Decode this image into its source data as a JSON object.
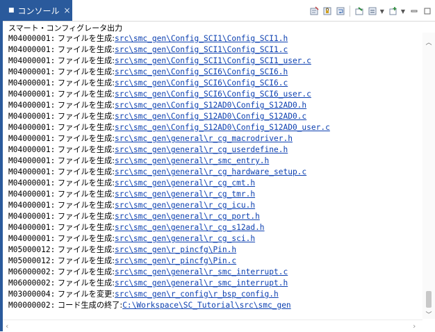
{
  "tab": {
    "icon": "console-icon",
    "label": "コンソール",
    "close": "×"
  },
  "toolbar": {
    "buttons": [
      "clear-console-icon",
      "scroll-lock-icon",
      "word-wrap-icon",
      "pin-console-icon",
      "display-selected-console-icon",
      "open-console-icon",
      "minimize-icon",
      "maximize-icon"
    ]
  },
  "console": {
    "title": "スマート・コンフィグレータ出力",
    "lines": [
      {
        "code": "M04000001:",
        "msg": " ファイルを生成:",
        "link": "src\\smc_gen\\Config_SCI1\\Config_SCI1.h"
      },
      {
        "code": "M04000001:",
        "msg": " ファイルを生成:",
        "link": "src\\smc_gen\\Config_SCI1\\Config_SCI1.c"
      },
      {
        "code": "M04000001:",
        "msg": " ファイルを生成:",
        "link": "src\\smc_gen\\Config_SCI1\\Config_SCI1_user.c"
      },
      {
        "code": "M04000001:",
        "msg": " ファイルを生成:",
        "link": "src\\smc_gen\\Config_SCI6\\Config_SCI6.h"
      },
      {
        "code": "M04000001:",
        "msg": " ファイルを生成:",
        "link": "src\\smc_gen\\Config_SCI6\\Config_SCI6.c"
      },
      {
        "code": "M04000001:",
        "msg": " ファイルを生成:",
        "link": "src\\smc_gen\\Config_SCI6\\Config_SCI6_user.c"
      },
      {
        "code": "M04000001:",
        "msg": " ファイルを生成:",
        "link": "src\\smc_gen\\Config_S12AD0\\Config_S12AD0.h"
      },
      {
        "code": "M04000001:",
        "msg": " ファイルを生成:",
        "link": "src\\smc_gen\\Config_S12AD0\\Config_S12AD0.c"
      },
      {
        "code": "M04000001:",
        "msg": " ファイルを生成:",
        "link": "src\\smc_gen\\Config_S12AD0\\Config_S12AD0_user.c"
      },
      {
        "code": "M04000001:",
        "msg": " ファイルを生成:",
        "link": "src\\smc_gen\\general\\r_cg_macrodriver.h"
      },
      {
        "code": "M04000001:",
        "msg": " ファイルを生成:",
        "link": "src\\smc_gen\\general\\r_cg_userdefine.h"
      },
      {
        "code": "M04000001:",
        "msg": " ファイルを生成:",
        "link": "src\\smc_gen\\general\\r_smc_entry.h"
      },
      {
        "code": "M04000001:",
        "msg": " ファイルを生成:",
        "link": "src\\smc_gen\\general\\r_cg_hardware_setup.c"
      },
      {
        "code": "M04000001:",
        "msg": " ファイルを生成:",
        "link": "src\\smc_gen\\general\\r_cg_cmt.h"
      },
      {
        "code": "M04000001:",
        "msg": " ファイルを生成:",
        "link": "src\\smc_gen\\general\\r_cg_tmr.h"
      },
      {
        "code": "M04000001:",
        "msg": " ファイルを生成:",
        "link": "src\\smc_gen\\general\\r_cg_icu.h"
      },
      {
        "code": "M04000001:",
        "msg": " ファイルを生成:",
        "link": "src\\smc_gen\\general\\r_cg_port.h"
      },
      {
        "code": "M04000001:",
        "msg": " ファイルを生成:",
        "link": "src\\smc_gen\\general\\r_cg_s12ad.h"
      },
      {
        "code": "M04000001:",
        "msg": " ファイルを生成:",
        "link": "src\\smc_gen\\general\\r_cg_sci.h"
      },
      {
        "code": "M05000012:",
        "msg": " ファイルを生成:",
        "link": "src\\smc_gen\\r_pincfg\\Pin.h"
      },
      {
        "code": "M05000012:",
        "msg": " ファイルを生成:",
        "link": "src\\smc_gen\\r_pincfg\\Pin.c"
      },
      {
        "code": "M06000002:",
        "msg": " ファイルを生成:",
        "link": "src\\smc_gen\\general\\r_smc_interrupt.c"
      },
      {
        "code": "M06000002:",
        "msg": " ファイルを生成:",
        "link": "src\\smc_gen\\general\\r_smc_interrupt.h"
      },
      {
        "code": "M03000004:",
        "msg": " ファイルを変更:",
        "link": "src\\smc_gen\\r_config\\r_bsp_config.h"
      },
      {
        "code": "M00000002:",
        "msg": " コード生成の終了:",
        "link": "C:\\Workspace\\SC_Tutorial\\src\\smc_gen"
      }
    ]
  }
}
